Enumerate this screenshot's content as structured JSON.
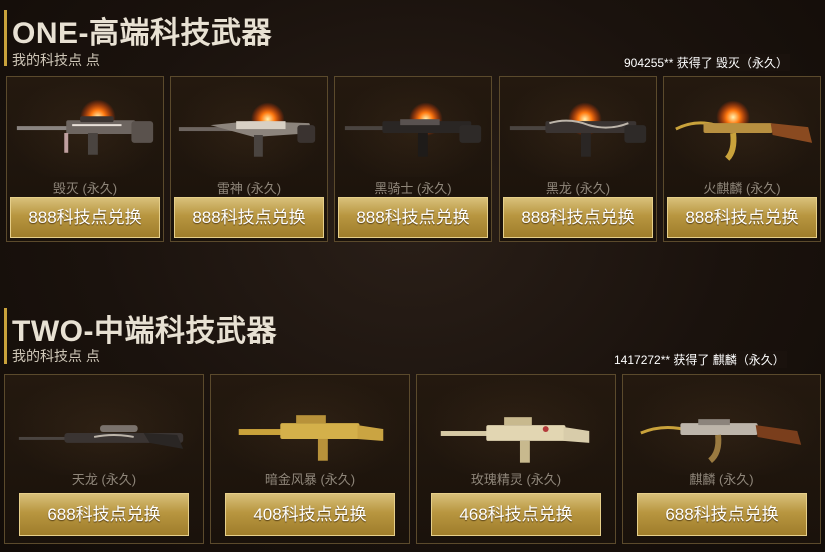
{
  "sections": [
    {
      "title": "ONE-高端科技武器",
      "points_label": "我的科技点 点",
      "ticker": "904255** 获得了 毁灭（永久）",
      "items": [
        {
          "name": "毁灭 (永久)",
          "button": "888科技点兑换"
        },
        {
          "name": "雷神 (永久)",
          "button": "888科技点兑换"
        },
        {
          "name": "黑骑士 (永久)",
          "button": "888科技点兑换"
        },
        {
          "name": "黑龙 (永久)",
          "button": "888科技点兑换"
        },
        {
          "name": "火麒麟 (永久)",
          "button": "888科技点兑换"
        }
      ]
    },
    {
      "title": "TWO-中端科技武器",
      "points_label": "我的科技点 点",
      "ticker": "1417272** 获得了 麒麟（永久）",
      "items": [
        {
          "name": "天龙 (永久)",
          "button": "688科技点兑换"
        },
        {
          "name": "暗金风暴 (永久)",
          "button": "408科技点兑换"
        },
        {
          "name": "玫瑰精灵 (永久)",
          "button": "468科技点兑换"
        },
        {
          "name": "麒麟 (永久)",
          "button": "688科技点兑换"
        }
      ]
    }
  ],
  "colors": {
    "accent_gold": "#c9a23b",
    "button_gold": "#b89640",
    "background": "#1a120d"
  }
}
